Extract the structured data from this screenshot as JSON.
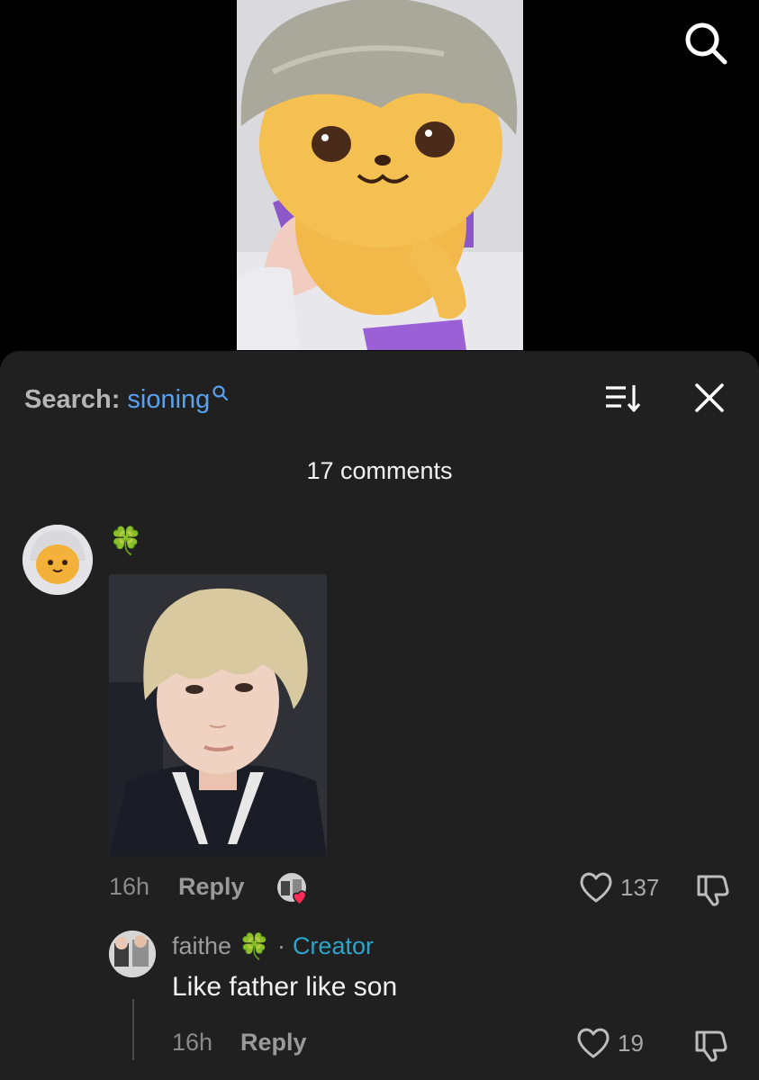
{
  "video": {
    "thumbnail_icon": "plush-bear-image"
  },
  "top_bar": {
    "search_icon": "search-icon"
  },
  "sheet": {
    "search_prefix": "Search:",
    "search_term": "sioning",
    "sort_icon": "sort-icon",
    "close_icon": "close-icon",
    "comment_count": "17 comments"
  },
  "comment": {
    "text": "🍀",
    "time": "16h",
    "reply_label": "Reply",
    "likes": "137"
  },
  "reply": {
    "username": "faithe",
    "name_emoji": "🍀",
    "separator": "·",
    "badge": "Creator",
    "text": "Like father like son",
    "time": "16h",
    "reply_label": "Reply",
    "likes": "19"
  },
  "colors": {
    "sheet_bg": "#202020",
    "accent_blue": "#5aa2ee",
    "creator_teal": "#2fa3c8",
    "heart_red": "#ff2d55"
  }
}
